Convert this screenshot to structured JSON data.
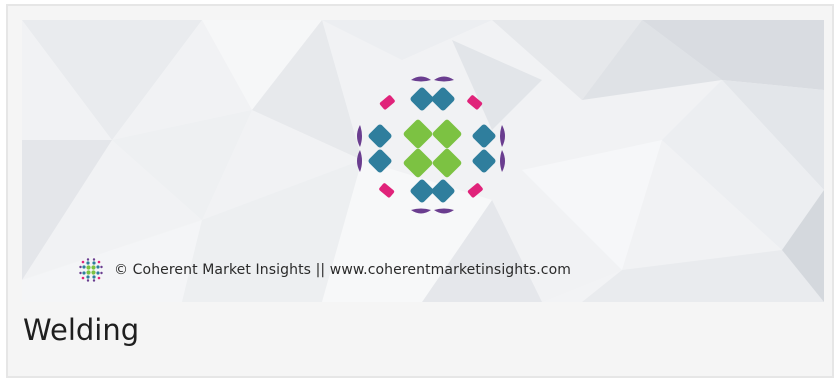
{
  "banner": {
    "watermark_text": "© Coherent Market Insights || www.coherentmarketinsights.com",
    "logo_icon": "coherent-market-insights-logo-icon",
    "colors": {
      "purple": "#6a3d8f",
      "magenta": "#e0237a",
      "teal": "#2f7e9d",
      "green": "#7cc242"
    }
  },
  "card": {
    "title": "Welding"
  }
}
